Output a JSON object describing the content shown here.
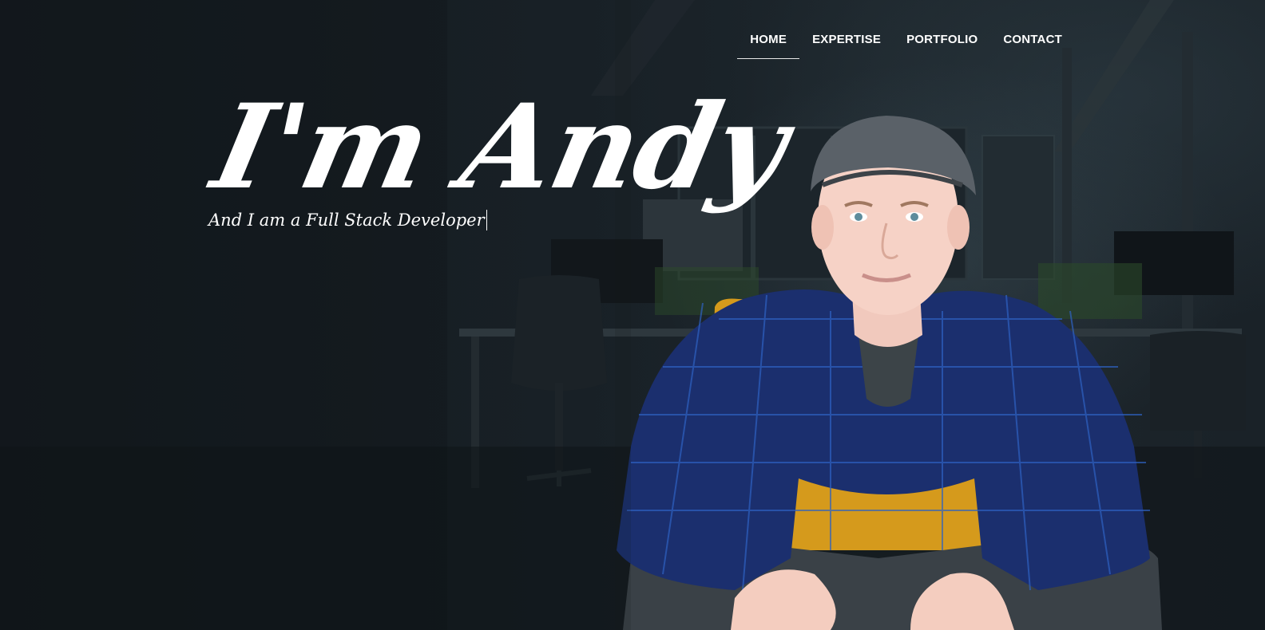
{
  "nav": {
    "items": [
      {
        "label": "HOME",
        "active": true
      },
      {
        "label": "EXPERTISE",
        "active": false
      },
      {
        "label": "PORTFOLIO",
        "active": false
      },
      {
        "label": "CONTACT",
        "active": false
      }
    ]
  },
  "hero": {
    "headline": "I'm Andy",
    "tagline": "And I am a Full Stack Developer"
  },
  "colors": {
    "background": "#14191e",
    "text": "#ffffff",
    "shirt": "#1b2f6e",
    "chair": "#d59a1c",
    "cap": "#5a6168"
  }
}
